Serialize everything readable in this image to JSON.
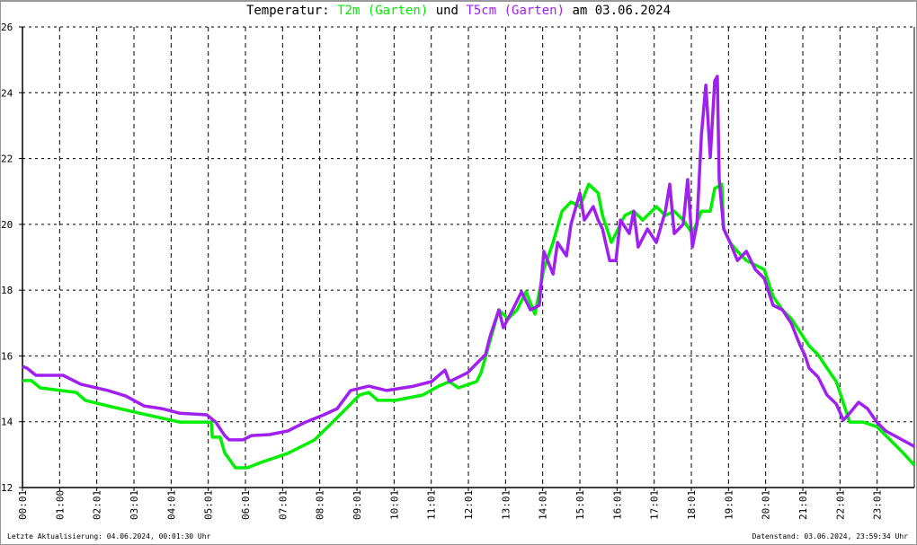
{
  "title": {
    "prefix": "Temperatur:",
    "series1": "T2m (Garten)",
    "mid": "und",
    "series2": "T5cm (Garten)",
    "suffix": "am 03.06.2024"
  },
  "footer": {
    "left": "Letzte Aktualisierung: 04.06.2024, 00:01:30 Uhr",
    "right": "Datenstand: 03.06.2024, 23:59:34 Uhr"
  },
  "chart_data": {
    "type": "line",
    "title": "Temperatur: T2m (Garten) und T5cm (Garten) am 03.06.2024",
    "xlabel": "",
    "ylabel": "",
    "xlim": [
      0,
      24
    ],
    "ylim": [
      12,
      26
    ],
    "grid": true,
    "y_ticks": [
      12,
      14,
      16,
      18,
      20,
      22,
      24,
      26
    ],
    "x_ticks": [
      {
        "hour": 0,
        "label": "00:01"
      },
      {
        "hour": 1,
        "label": "01:00"
      },
      {
        "hour": 2,
        "label": "02:01"
      },
      {
        "hour": 3,
        "label": "03:01"
      },
      {
        "hour": 4,
        "label": "04:01"
      },
      {
        "hour": 5,
        "label": "05:01"
      },
      {
        "hour": 6,
        "label": "06:01"
      },
      {
        "hour": 7,
        "label": "07:01"
      },
      {
        "hour": 8,
        "label": "08:01"
      },
      {
        "hour": 9,
        "label": "09:01"
      },
      {
        "hour": 10,
        "label": "10:01"
      },
      {
        "hour": 11,
        "label": "11:01"
      },
      {
        "hour": 12,
        "label": "12:01"
      },
      {
        "hour": 13,
        "label": "13:01"
      },
      {
        "hour": 14,
        "label": "14:01"
      },
      {
        "hour": 15,
        "label": "15:01"
      },
      {
        "hour": 16,
        "label": "16:01"
      },
      {
        "hour": 17,
        "label": "17:01"
      },
      {
        "hour": 18,
        "label": "18:01"
      },
      {
        "hour": 19,
        "label": "19:01"
      },
      {
        "hour": 20,
        "label": "20:01"
      },
      {
        "hour": 21,
        "label": "21:01"
      },
      {
        "hour": 22,
        "label": "22:01"
      },
      {
        "hour": 23,
        "label": "23:01"
      }
    ],
    "series": [
      {
        "name": "T2m (Garten)",
        "color": "#00ee00",
        "points": [
          [
            0,
            15.25
          ],
          [
            0.24,
            15.25
          ],
          [
            0.48,
            15.03
          ],
          [
            1.45,
            14.89
          ],
          [
            1.69,
            14.65
          ],
          [
            2.3,
            14.48
          ],
          [
            3.15,
            14.26
          ],
          [
            4.23,
            13.99
          ],
          [
            5.08,
            13.99
          ],
          [
            5.11,
            13.53
          ],
          [
            5.32,
            13.53
          ],
          [
            5.44,
            13.06
          ],
          [
            5.73,
            12.6
          ],
          [
            6.05,
            12.6
          ],
          [
            6.41,
            12.76
          ],
          [
            7.14,
            13.04
          ],
          [
            7.86,
            13.45
          ],
          [
            8.35,
            13.99
          ],
          [
            8.71,
            14.4
          ],
          [
            9.07,
            14.81
          ],
          [
            9.32,
            14.89
          ],
          [
            9.56,
            14.65
          ],
          [
            10.04,
            14.65
          ],
          [
            10.77,
            14.81
          ],
          [
            11.2,
            15.08
          ],
          [
            11.49,
            15.22
          ],
          [
            11.73,
            15.03
          ],
          [
            12.22,
            15.22
          ],
          [
            12.34,
            15.49
          ],
          [
            12.58,
            16.45
          ],
          [
            12.82,
            17.4
          ],
          [
            13.07,
            17.13
          ],
          [
            13.31,
            17.4
          ],
          [
            13.55,
            17.95
          ],
          [
            13.79,
            17.27
          ],
          [
            14.03,
            18.63
          ],
          [
            14.28,
            19.45
          ],
          [
            14.52,
            20.4
          ],
          [
            14.76,
            20.68
          ],
          [
            15.0,
            20.54
          ],
          [
            15.24,
            21.22
          ],
          [
            15.49,
            20.95
          ],
          [
            15.61,
            20.27
          ],
          [
            15.85,
            19.45
          ],
          [
            16.21,
            20.27
          ],
          [
            16.45,
            20.4
          ],
          [
            16.69,
            20.13
          ],
          [
            17.06,
            20.54
          ],
          [
            17.3,
            20.27
          ],
          [
            17.54,
            20.4
          ],
          [
            17.78,
            20.13
          ],
          [
            18.03,
            19.72
          ],
          [
            18.27,
            20.4
          ],
          [
            18.51,
            20.4
          ],
          [
            18.63,
            21.09
          ],
          [
            18.82,
            21.22
          ],
          [
            18.87,
            19.86
          ],
          [
            19.04,
            19.45
          ],
          [
            19.24,
            19.18
          ],
          [
            19.48,
            18.9
          ],
          [
            19.96,
            18.63
          ],
          [
            20.2,
            17.81
          ],
          [
            20.45,
            17.4
          ],
          [
            20.69,
            17.13
          ],
          [
            20.93,
            16.72
          ],
          [
            21.17,
            16.31
          ],
          [
            21.41,
            16.04
          ],
          [
            21.65,
            15.63
          ],
          [
            21.9,
            15.22
          ],
          [
            22.02,
            14.81
          ],
          [
            22.26,
            13.99
          ],
          [
            22.62,
            13.99
          ],
          [
            22.99,
            13.85
          ],
          [
            23.35,
            13.45
          ],
          [
            23.71,
            13.04
          ],
          [
            24.0,
            12.68
          ]
        ]
      },
      {
        "name": "T5cm (Garten)",
        "color": "#a020f0",
        "points": [
          [
            0,
            15.68
          ],
          [
            0.12,
            15.63
          ],
          [
            0.36,
            15.41
          ],
          [
            1.09,
            15.41
          ],
          [
            1.57,
            15.14
          ],
          [
            2.3,
            14.95
          ],
          [
            2.78,
            14.78
          ],
          [
            3.27,
            14.48
          ],
          [
            3.75,
            14.4
          ],
          [
            4.23,
            14.26
          ],
          [
            4.96,
            14.21
          ],
          [
            5.2,
            13.99
          ],
          [
            5.44,
            13.58
          ],
          [
            5.56,
            13.45
          ],
          [
            5.93,
            13.45
          ],
          [
            6.17,
            13.58
          ],
          [
            6.65,
            13.61
          ],
          [
            7.14,
            13.72
          ],
          [
            7.62,
            13.99
          ],
          [
            8.11,
            14.21
          ],
          [
            8.47,
            14.4
          ],
          [
            8.83,
            14.95
          ],
          [
            9.32,
            15.08
          ],
          [
            9.8,
            14.95
          ],
          [
            10.53,
            15.08
          ],
          [
            11.01,
            15.22
          ],
          [
            11.37,
            15.57
          ],
          [
            11.49,
            15.22
          ],
          [
            11.98,
            15.49
          ],
          [
            12.22,
            15.77
          ],
          [
            12.46,
            16.04
          ],
          [
            12.58,
            16.58
          ],
          [
            12.82,
            17.4
          ],
          [
            12.94,
            16.86
          ],
          [
            13.19,
            17.4
          ],
          [
            13.43,
            17.95
          ],
          [
            13.67,
            17.4
          ],
          [
            13.91,
            17.54
          ],
          [
            14.03,
            19.18
          ],
          [
            14.28,
            18.49
          ],
          [
            14.4,
            19.45
          ],
          [
            14.64,
            19.04
          ],
          [
            14.76,
            20.0
          ],
          [
            15.0,
            20.95
          ],
          [
            15.12,
            20.13
          ],
          [
            15.36,
            20.54
          ],
          [
            15.49,
            20.13
          ],
          [
            15.61,
            19.86
          ],
          [
            15.8,
            18.9
          ],
          [
            15.97,
            18.9
          ],
          [
            16.09,
            20.13
          ],
          [
            16.33,
            19.72
          ],
          [
            16.45,
            20.4
          ],
          [
            16.57,
            19.31
          ],
          [
            16.82,
            19.86
          ],
          [
            17.06,
            19.45
          ],
          [
            17.3,
            20.4
          ],
          [
            17.42,
            21.22
          ],
          [
            17.54,
            19.72
          ],
          [
            17.78,
            20.0
          ],
          [
            17.9,
            21.36
          ],
          [
            18.03,
            19.31
          ],
          [
            18.15,
            20.0
          ],
          [
            18.27,
            22.72
          ],
          [
            18.39,
            24.23
          ],
          [
            18.51,
            22.04
          ],
          [
            18.63,
            24.36
          ],
          [
            18.7,
            24.5
          ],
          [
            18.75,
            21.36
          ],
          [
            18.87,
            19.86
          ],
          [
            19.04,
            19.45
          ],
          [
            19.24,
            18.9
          ],
          [
            19.48,
            19.18
          ],
          [
            19.72,
            18.63
          ],
          [
            19.96,
            18.36
          ],
          [
            20.2,
            17.54
          ],
          [
            20.45,
            17.4
          ],
          [
            20.69,
            16.99
          ],
          [
            20.93,
            16.31
          ],
          [
            21.05,
            16.04
          ],
          [
            21.17,
            15.63
          ],
          [
            21.41,
            15.36
          ],
          [
            21.65,
            14.81
          ],
          [
            21.9,
            14.54
          ],
          [
            22.09,
            14.05
          ],
          [
            22.26,
            14.26
          ],
          [
            22.5,
            14.59
          ],
          [
            22.74,
            14.4
          ],
          [
            22.99,
            13.99
          ],
          [
            23.23,
            13.72
          ],
          [
            23.59,
            13.5
          ],
          [
            24.0,
            13.25
          ]
        ]
      }
    ]
  }
}
